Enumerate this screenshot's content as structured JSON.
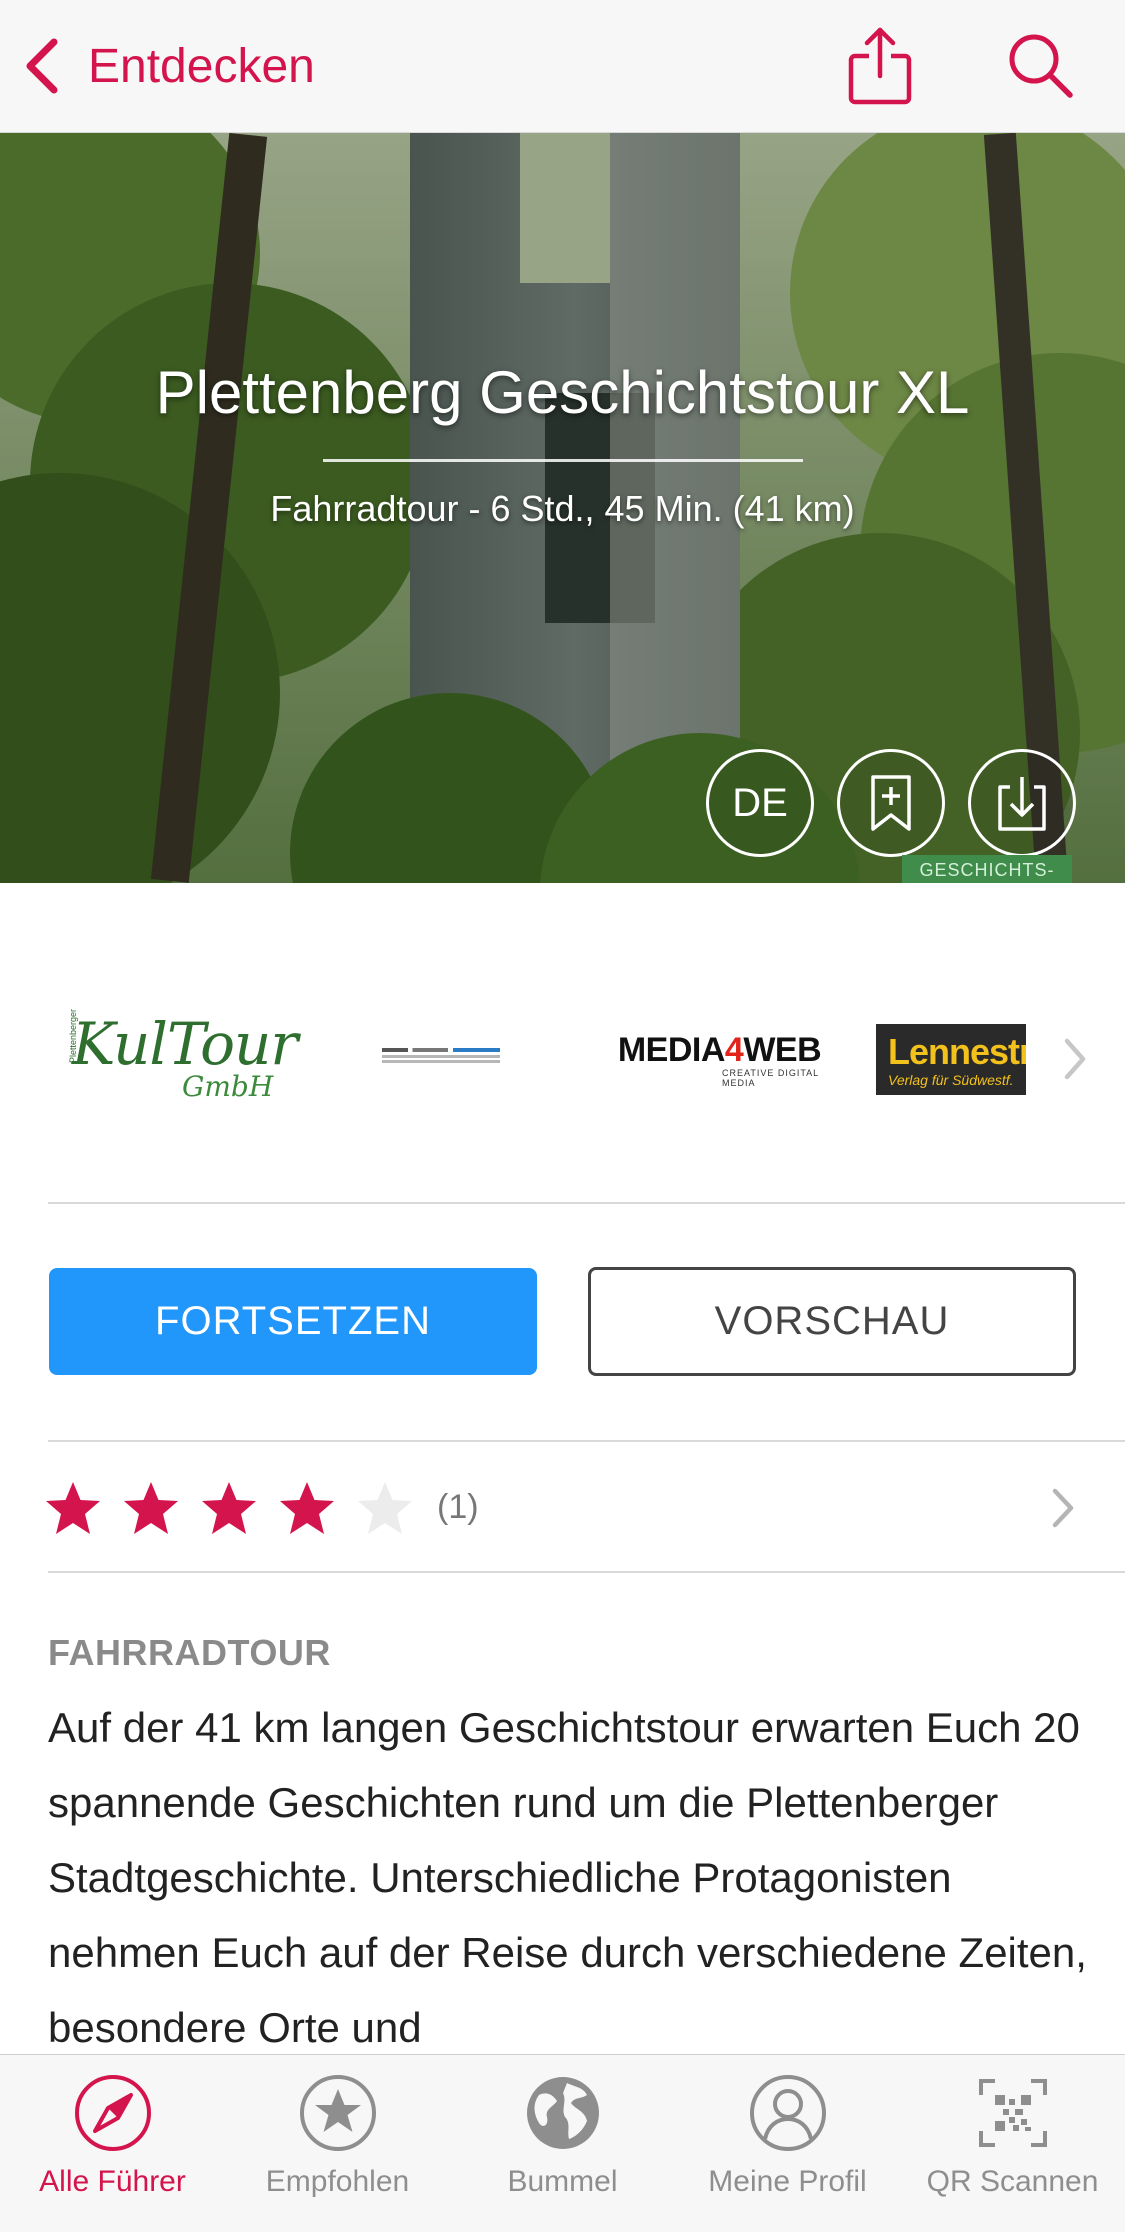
{
  "nav": {
    "back_label": "Entdecken",
    "share_icon": "share-icon",
    "search_icon": "search-icon",
    "accent_color": "#d4144c"
  },
  "hero": {
    "title": "Plettenberg Geschichtstour XL",
    "subtitle": "Fahrradtour - 6 Std., 45 Min. (41 km)",
    "language_label": "DE",
    "tag_text": "GESCHICHTS-",
    "bookmark_icon": "bookmark-add-icon",
    "download_icon": "download-icon"
  },
  "sponsors": {
    "logos": [
      {
        "name": "KulTour GmbH",
        "main": "KulTour",
        "sub": "GmbH",
        "side": "Plettenberger"
      },
      {
        "name": "government-logo"
      },
      {
        "name": "MEDIA4WEB",
        "main_a": "MEDIA",
        "main_b": "4",
        "main_c": "WEB",
        "sub": "CREATIVE DIGITAL MEDIA"
      },
      {
        "name": "Lennestra",
        "main": "Lennestra",
        "sub": "Verlag für Südwestf."
      }
    ]
  },
  "actions": {
    "primary_label": "FORTSETZEN",
    "secondary_label": "VORSCHAU",
    "primary_color": "#2196fb"
  },
  "rating": {
    "stars": 4,
    "max": 5,
    "count_label": "(1)",
    "star_color": "#d4144c"
  },
  "description": {
    "kicker": "FAHRRADTOUR",
    "text": "Auf der 41 km langen Geschichtstour erwarten Euch 20 spannende Geschichten rund um die Plettenberger Stadtgeschichte. Unterschiedliche Protagonisten nehmen Euch auf der Reise durch verschiedene Zeiten, besondere Orte und"
  },
  "tabbar": {
    "tabs": [
      {
        "label": "Alle Führer",
        "icon": "compass-icon",
        "active": true
      },
      {
        "label": "Empfohlen",
        "icon": "star-badge-icon",
        "active": false
      },
      {
        "label": "Bummel",
        "icon": "globe-icon",
        "active": false
      },
      {
        "label": "Meine Profil",
        "icon": "profile-icon",
        "active": false
      },
      {
        "label": "QR Scannen",
        "icon": "qr-code-icon",
        "active": false
      }
    ]
  }
}
